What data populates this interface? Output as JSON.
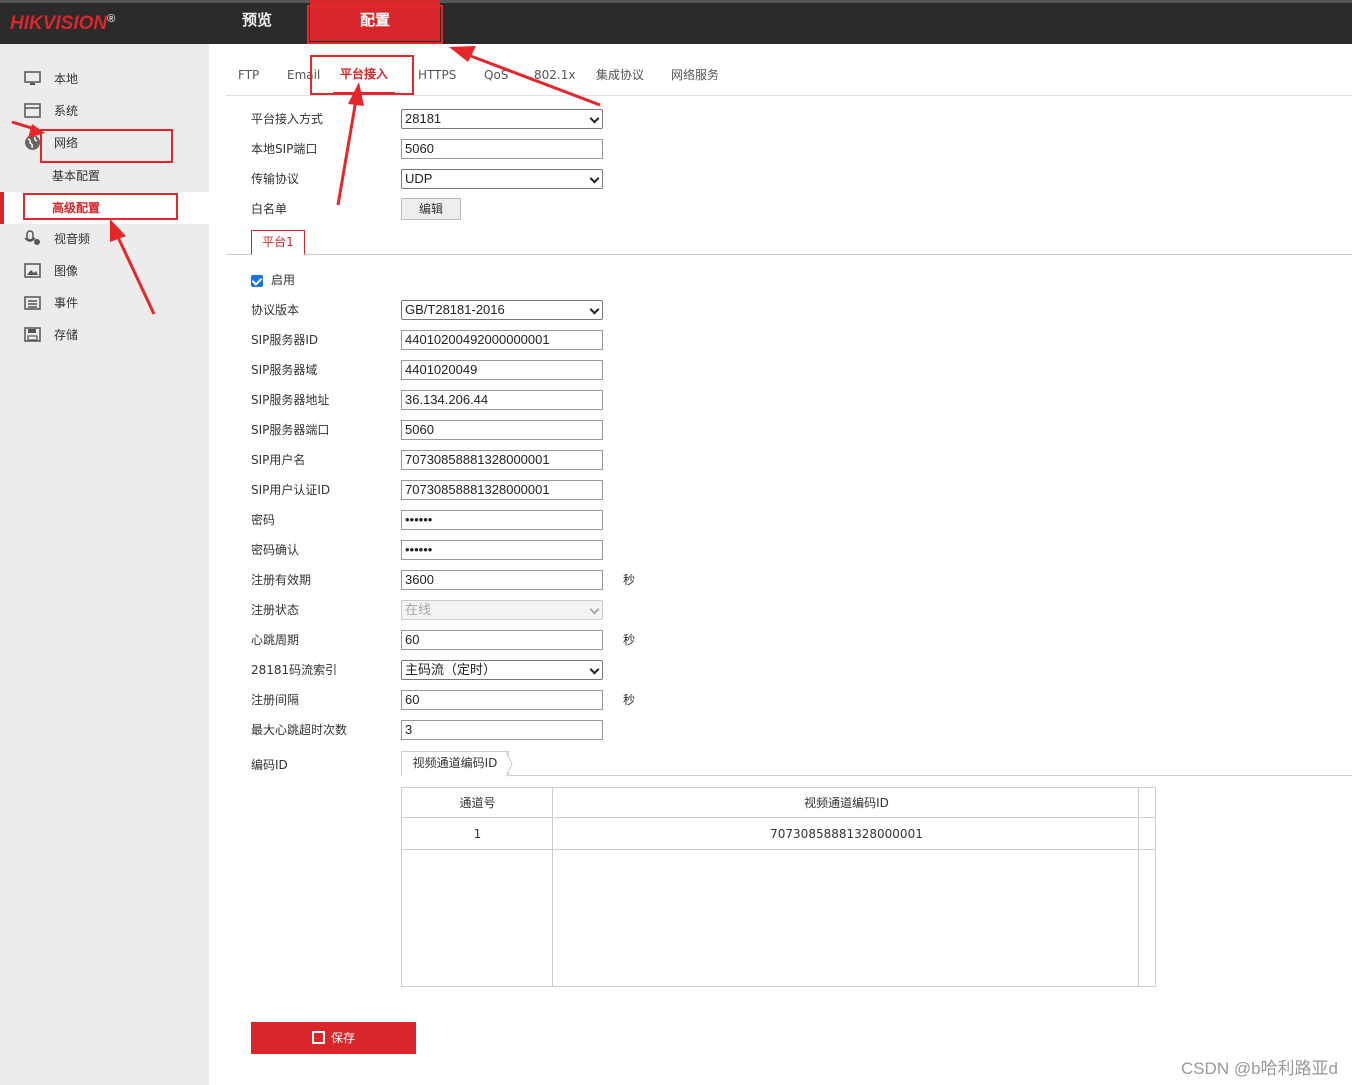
{
  "header": {
    "logo": "HIKVISION",
    "logo_mark": "®",
    "nav": {
      "preview": "预览",
      "config": "配置"
    }
  },
  "sidebar": {
    "items": [
      {
        "label": "本地",
        "icon": "monitor-icon"
      },
      {
        "label": "系统",
        "icon": "system-icon"
      },
      {
        "label": "网络",
        "icon": "globe-icon"
      },
      {
        "label": "视音频",
        "icon": "mic-icon"
      },
      {
        "label": "图像",
        "icon": "image-icon"
      },
      {
        "label": "事件",
        "icon": "calendar-icon"
      },
      {
        "label": "存储",
        "icon": "floppy-icon"
      }
    ],
    "subitems": [
      {
        "label": "基本配置"
      },
      {
        "label": "高级配置",
        "active": true
      }
    ]
  },
  "tabs": [
    "FTP",
    "Email",
    "平台接入",
    "HTTPS",
    "QoS",
    "802.1x",
    "集成协议",
    "网络服务"
  ],
  "platform": {
    "access_mode_label": "平台接入方式",
    "access_mode_value": "28181",
    "sip_port_label": "本地SIP端口",
    "sip_port_value": "5060",
    "transport_label": "传输协议",
    "transport_value": "UDP",
    "whitelist_label": "白名单",
    "edit_button": "编辑",
    "subtab": "平台1"
  },
  "form": {
    "enable_label": "启用",
    "fields": [
      {
        "label": "协议版本",
        "value": "GB/T28181-2016",
        "type": "select"
      },
      {
        "label": "SIP服务器ID",
        "value": "44010200492000000001"
      },
      {
        "label": "SIP服务器域",
        "value": "4401020049"
      },
      {
        "label": "SIP服务器地址",
        "value": "36.134.206.44"
      },
      {
        "label": "SIP服务器端口",
        "value": "5060"
      },
      {
        "label": "SIP用户名",
        "value": "70730858881328000001"
      },
      {
        "label": "SIP用户认证ID",
        "value": "70730858881328000001"
      },
      {
        "label": "密码",
        "value": "••••••"
      },
      {
        "label": "密码确认",
        "value": "••••••"
      },
      {
        "label": "注册有效期",
        "value": "3600",
        "unit": "秒"
      },
      {
        "label": "注册状态",
        "value": "在线",
        "type": "select-disabled"
      },
      {
        "label": "心跳周期",
        "value": "60",
        "unit": "秒"
      },
      {
        "label": "28181码流索引",
        "value": "主码流（定时）",
        "type": "select"
      },
      {
        "label": "注册间隔",
        "value": "60",
        "unit": "秒"
      },
      {
        "label": "最大心跳超时次数",
        "value": "3"
      }
    ]
  },
  "encode": {
    "label": "编码ID",
    "tab": "视频通道编码ID",
    "headers": [
      "通道号",
      "视频通道编码ID"
    ],
    "rows": [
      {
        "channel": "1",
        "code": "70730858881328000001"
      }
    ]
  },
  "save_button": "保存",
  "watermark": "CSDN @b哈利路亚d",
  "colors": {
    "accent": "#d8262a",
    "header_bg": "#2b2b2b",
    "sidebar_bg": "#ececec",
    "annotation": "#e5262a"
  }
}
